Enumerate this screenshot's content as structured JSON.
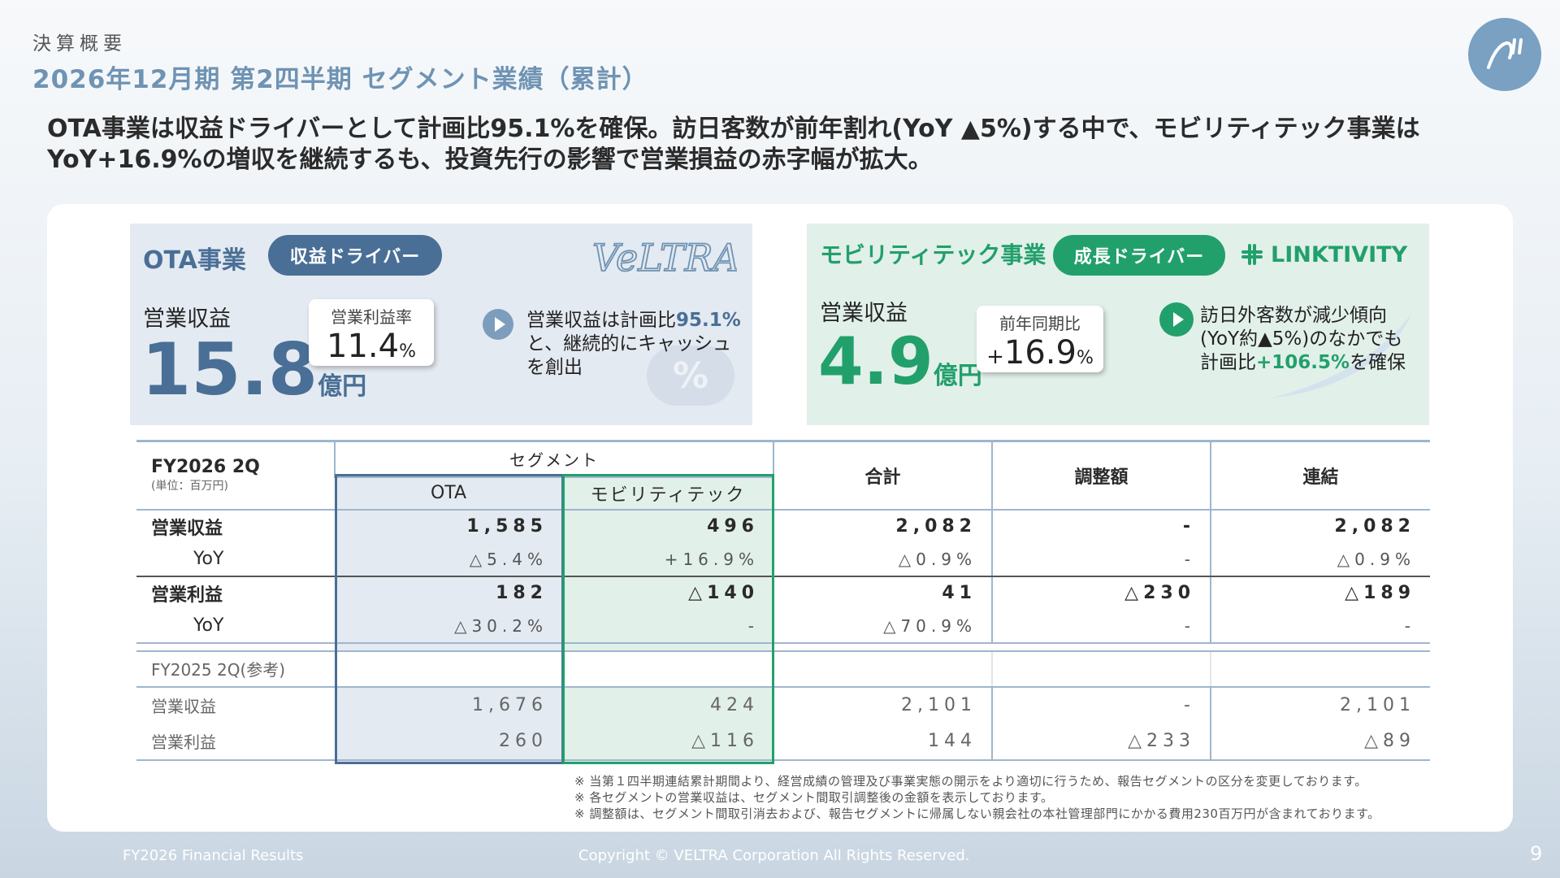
{
  "header": {
    "small_title": "決算概要",
    "main_title": "2026年12月期 第2四半期 セグメント業績（累計）"
  },
  "lead": {
    "line1": "OTA事業は収益ドライバーとして計画比95.1%を確保。訪日客数が前年割れ(YoY ▲5%)する中で、モビリティテック事業は",
    "line2": "YoY+16.9%の増収を継続するも、投資先行の影響で営業損益の赤字幅が拡大。"
  },
  "ota": {
    "title": "OTA事業",
    "badge": "収益ドライバー",
    "brand": "VeLTRA",
    "revenue_label": "営業収益",
    "revenue_value": "15.8",
    "revenue_unit": "億円",
    "kpi_label": "営業利益率",
    "kpi_value": "11.4",
    "kpi_unit": "%",
    "note_pre": "営業収益は計画比",
    "note_hl": "95.1%",
    "note_post": "と、継続的にキャッシュを創出",
    "deco_symbol": "%"
  },
  "mobility": {
    "title": "モビリティテック事業",
    "badge": "成長ドライバー",
    "brand": "LINKTIVITY",
    "revenue_label": "営業収益",
    "revenue_value": "4.9",
    "revenue_unit": "億円",
    "kpi_label": "前年同期比",
    "kpi_sign": "+",
    "kpi_value": "16.9",
    "kpi_unit": "%",
    "note_line1": "訪日外客数が減少傾向",
    "note_line2": "(YoY約▲5%)のなかでも",
    "note_line3_pre": "計画比",
    "note_line3_hl": "+106.5%",
    "note_line3_post": "を確保"
  },
  "table": {
    "period": "FY2026 2Q",
    "unit": "(単位：百万円)",
    "segment_header": "セグメント",
    "col_ota": "OTA",
    "col_mob": "モビリティテック",
    "col_total": "合計",
    "col_adj": "調整額",
    "col_cons": "連結",
    "rows": [
      {
        "label": "営業収益",
        "ota": "1,585",
        "mob": "496",
        "total": "2,082",
        "adj": "-",
        "cons": "2,082"
      },
      {
        "label": "YoY",
        "ota": "△5.4%",
        "mob": "+16.9%",
        "total": "△0.9%",
        "adj": "-",
        "cons": "△0.9%"
      },
      {
        "label": "営業利益",
        "ota": "182",
        "mob": "△140",
        "total": "41",
        "adj": "△230",
        "cons": "△189"
      },
      {
        "label": "YoY",
        "ota": "△30.2%",
        "mob": "-",
        "total": "△70.9%",
        "adj": "-",
        "cons": "-"
      }
    ],
    "ref_label": "FY2025 2Q(参考)",
    "ref_rows": [
      {
        "label": "営業収益",
        "ota": "1,676",
        "mob": "424",
        "total": "2,101",
        "adj": "-",
        "cons": "2,101"
      },
      {
        "label": "営業利益",
        "ota": "260",
        "mob": "△116",
        "total": "144",
        "adj": "△233",
        "cons": "△89"
      }
    ]
  },
  "footnotes": [
    "※ 当第１四半期連結累計期間より、経営成績の管理及び事業実態の開示をより適切に行うため、報告セグメントの区分を変更しております。",
    "※ 各セグメントの営業収益は、セグメント間取引調整後の金額を表示しております。",
    "※ 調整額は、セグメント間取引消去および、報告セグメントに帰属しない親会社の本社管理部門にかかる費用230百万円が含まれております。"
  ],
  "footer": {
    "left": "FY2026 Financial Results",
    "center": "Copyright © VELTRA Corporation All Rights Reserved.",
    "page": "9"
  },
  "colors": {
    "ota_accent": "#4a6f96",
    "mob_accent": "#22a06b",
    "title_blue": "#6f93b3"
  }
}
